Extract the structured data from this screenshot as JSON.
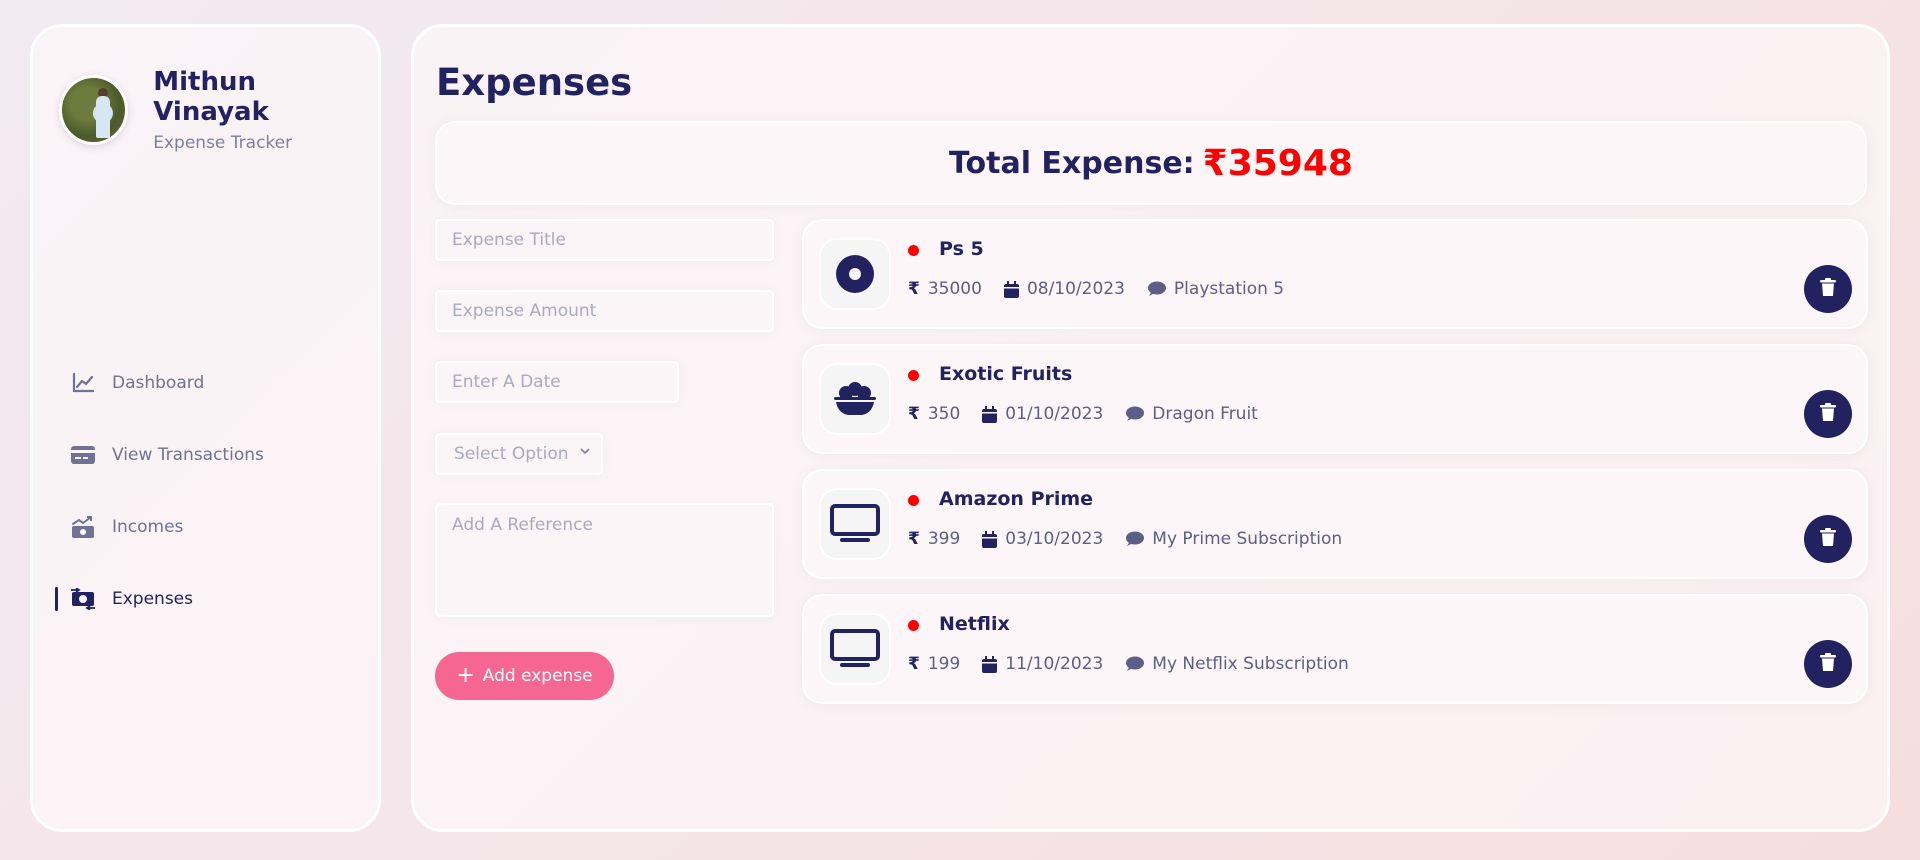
{
  "profile": {
    "name": "Mithun Vinayak",
    "subtitle": "Expense Tracker"
  },
  "nav": {
    "items": [
      {
        "label": "Dashboard",
        "icon": "chart-line-icon",
        "active": false
      },
      {
        "label": "View Transactions",
        "icon": "credit-card-icon",
        "active": false
      },
      {
        "label": "Incomes",
        "icon": "money-bill-trend-up-icon",
        "active": false
      },
      {
        "label": "Expenses",
        "icon": "money-bill-transfer-icon",
        "active": true
      }
    ]
  },
  "page": {
    "title": "Expenses"
  },
  "total": {
    "label": "Total Expense:",
    "value": "₹35948",
    "value_color": "#ff0000"
  },
  "form": {
    "title_placeholder": "Expense Title",
    "amount_placeholder": "Expense Amount",
    "date_placeholder": "Enter A Date",
    "category_selected": "Select Option",
    "reference_placeholder": "Add A Reference",
    "add_button": {
      "plus": "+",
      "label": "Add expense"
    }
  },
  "expenses": [
    {
      "title": "Ps 5",
      "currency": "₹",
      "amount": "35000",
      "date": "08/10/2023",
      "note": "Playstation 5",
      "icon": "disc-icon"
    },
    {
      "title": "Exotic Fruits",
      "currency": "₹",
      "amount": "350",
      "date": "01/10/2023",
      "note": "Dragon Fruit",
      "icon": "bowl-food-icon"
    },
    {
      "title": "Amazon Prime",
      "currency": "₹",
      "amount": "399",
      "date": "03/10/2023",
      "note": "My Prime Subscription",
      "icon": "tv-icon"
    },
    {
      "title": "Netflix",
      "currency": "₹",
      "amount": "199",
      "date": "11/10/2023",
      "note": "My Netflix Subscription",
      "icon": "tv-icon"
    }
  ],
  "colors": {
    "primary": "#222260",
    "accent": "#f56692",
    "expense_dot": "#ff0000"
  }
}
